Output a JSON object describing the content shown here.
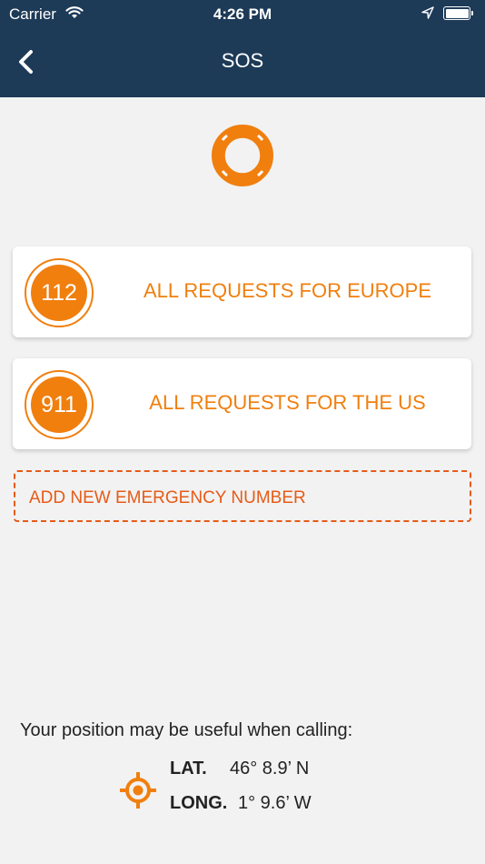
{
  "status_bar": {
    "carrier": "Carrier",
    "time": "4:26 PM",
    "icons": [
      "wifi-icon",
      "location-arrow-icon",
      "battery-icon"
    ]
  },
  "nav": {
    "title": "SOS",
    "back_icon": "chevron-left-icon"
  },
  "header_icon": "lifebuoy-icon",
  "emergency_numbers": [
    {
      "number": "112",
      "label": "ALL REQUESTS FOR EUROPE"
    },
    {
      "number": "911",
      "label": "ALL REQUESTS FOR THE US"
    }
  ],
  "add_button": {
    "label": "ADD NEW EMERGENCY NUMBER"
  },
  "position": {
    "note": "Your position may be useful when calling:",
    "icon": "target-icon",
    "lat_label": "LAT.",
    "lat_value": "46° 8.9’ N",
    "long_label": "LONG.",
    "long_value": "1° 9.6’ W"
  },
  "colors": {
    "nav_background": "#1d3a57",
    "accent_orange": "#f07f0e",
    "dashed_border": "#e65b17",
    "page_background": "#f2f2f2"
  }
}
